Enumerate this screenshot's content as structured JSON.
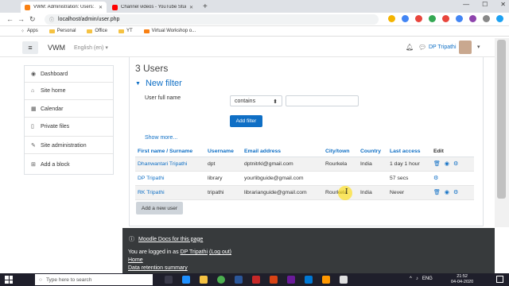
{
  "browser": {
    "tabs": [
      {
        "title": "VWM: Administration: Users: Ac",
        "active": true,
        "favicon_color": "#f98012"
      },
      {
        "title": "Channel videos - YouTube Studio",
        "active": false,
        "favicon_color": "#ff0000"
      }
    ],
    "url": "localhost/admin/user.php",
    "bookmarks": [
      {
        "label": "Apps",
        "type": "apps"
      },
      {
        "label": "Personal",
        "type": "folder"
      },
      {
        "label": "Office",
        "type": "folder"
      },
      {
        "label": "YT",
        "type": "folder"
      },
      {
        "label": "Virtual Workshop o...",
        "type": "page"
      }
    ]
  },
  "navbar": {
    "brand": "VWM",
    "language": "English (en)",
    "user_name": "DP Tripathi"
  },
  "sidebar": {
    "items": [
      {
        "label": "Dashboard",
        "icon": "dashboard-icon"
      },
      {
        "label": "Site home",
        "icon": "home-icon"
      },
      {
        "label": "Calendar",
        "icon": "calendar-icon"
      },
      {
        "label": "Private files",
        "icon": "file-icon"
      },
      {
        "label": "Site administration",
        "icon": "wrench-icon"
      }
    ],
    "add_block": "Add a block"
  },
  "main": {
    "users_count": "3 Users",
    "new_filter": "New filter",
    "filter_label": "User full name",
    "filter_select": "contains",
    "filter_value": "",
    "add_filter": "Add filter",
    "show_more": "Show more..."
  },
  "table": {
    "headers": {
      "name": "First name / Surname",
      "username": "Username",
      "email": "Email address",
      "city": "City/town",
      "country": "Country",
      "last_access": "Last access",
      "edit": "Edit"
    },
    "rows": [
      {
        "name": "Dhanwantari Tripathi",
        "username": "dpt",
        "email": "dptnitrkl@gmail.com",
        "city": "Rourkela",
        "country": "India",
        "last_access": "1 day 1 hour"
      },
      {
        "name": "DP Tripathi",
        "username": "library",
        "email": "yourlibguide@gmail.com",
        "city": "",
        "country": "",
        "last_access": "57 secs"
      },
      {
        "name": "RK Tripathi",
        "username": "tripathi",
        "email": "librarianguide@gmail.com",
        "city": "Rourkela",
        "country": "India",
        "last_access": "Never"
      }
    ],
    "add_user": "Add a new user"
  },
  "footer": {
    "docs_link": "Moodle Docs for this page",
    "logged_prefix": "You are logged in as",
    "logged_user": "DP Tripathi",
    "logout": "(Log out)",
    "home": "Home",
    "data_retention": "Data retention summary"
  },
  "taskbar": {
    "search_placeholder": "Type here to search",
    "language": "ENG",
    "time": "21:52",
    "date": "04-04-2020"
  }
}
